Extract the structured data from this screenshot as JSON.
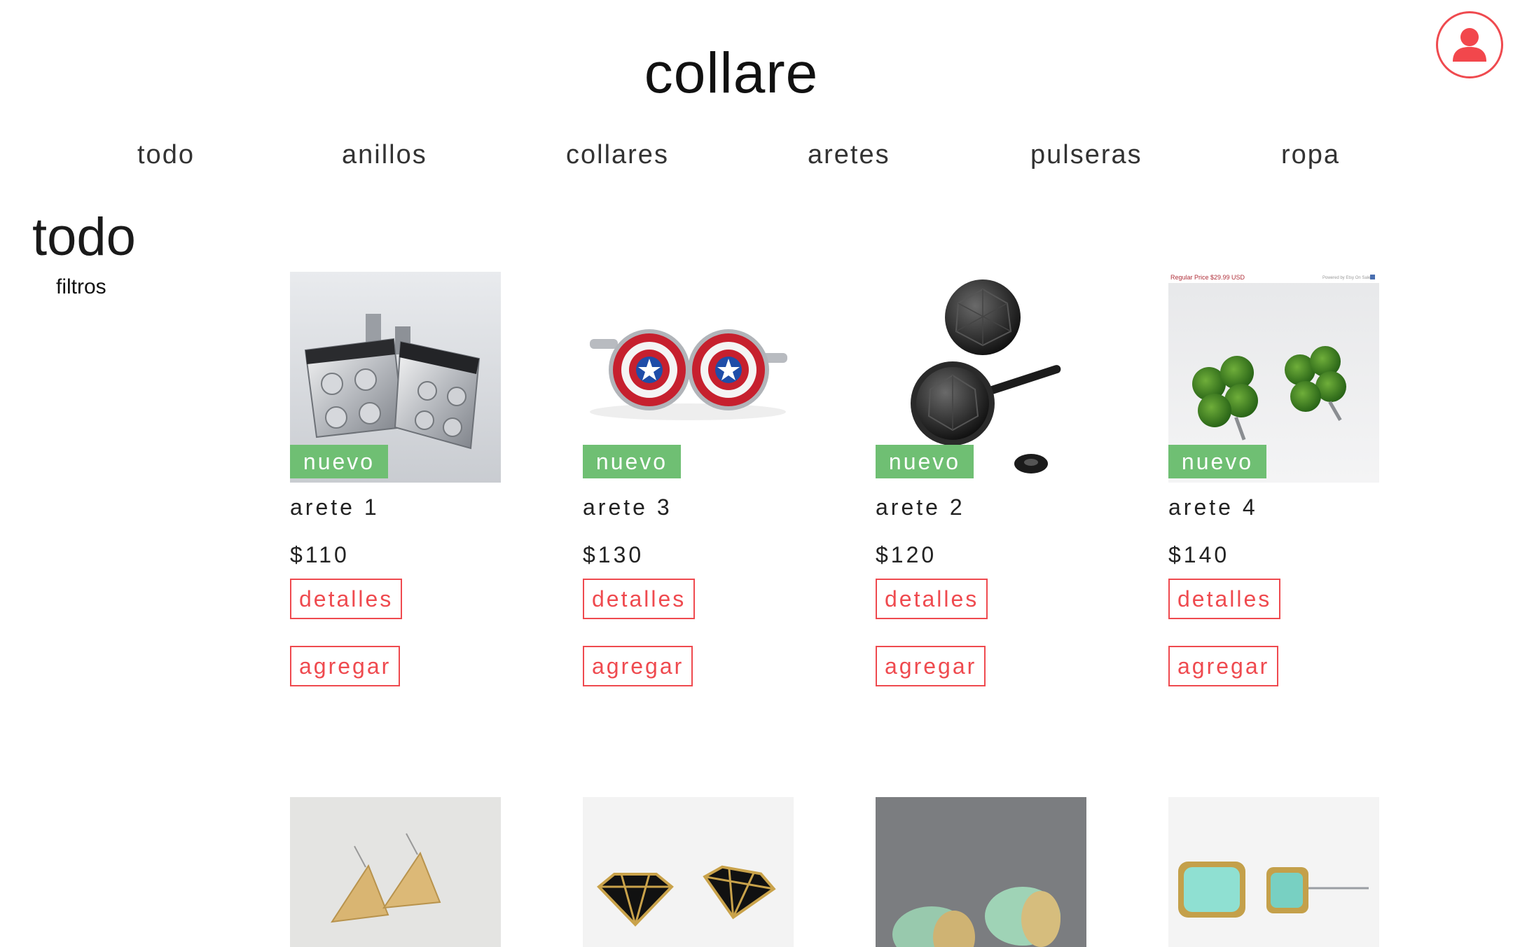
{
  "brand": {
    "title": "collare"
  },
  "nav": {
    "items": [
      "todo",
      "anillos",
      "collares",
      "aretes",
      "pulseras",
      "ropa"
    ]
  },
  "section": {
    "title": "todo",
    "filters_label": "filtros"
  },
  "labels": {
    "badge": "nuevo",
    "details": "detalles",
    "add": "agregar"
  },
  "sale_banner": {
    "text": "Regular Price $29.99 USD",
    "right": "Powered by Etsy On Sale"
  },
  "products": [
    {
      "name": "arete 1",
      "price": "$110",
      "badge": "nuevo",
      "image": "lego-cufflinks"
    },
    {
      "name": "arete 3",
      "price": "$130",
      "badge": "nuevo",
      "image": "shield-cufflinks"
    },
    {
      "name": "arete 2",
      "price": "$120",
      "badge": "nuevo",
      "image": "black-gem-studs"
    },
    {
      "name": "arete 4",
      "price": "$140",
      "badge": "nuevo",
      "image": "clover-studs"
    }
  ],
  "products_row2": [
    {
      "image": "gold-triangle-studs"
    },
    {
      "image": "black-diamond-studs"
    },
    {
      "image": "mint-gold-dipped-studs"
    },
    {
      "image": "mint-rectangle-studs"
    }
  ],
  "colors": {
    "accent": "#ef4a4f",
    "badge": "#6fbf73"
  }
}
